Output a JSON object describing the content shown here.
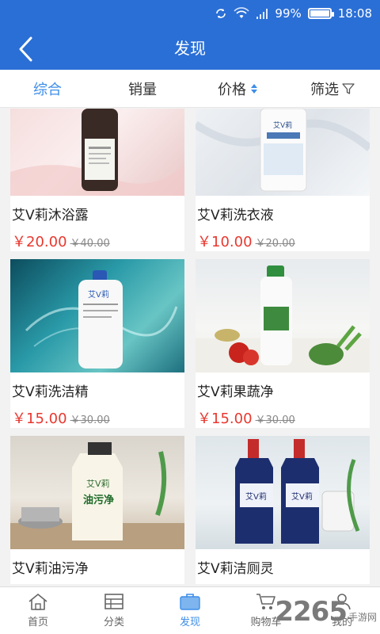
{
  "status_bar": {
    "battery": "99%",
    "time": "18:08",
    "battery_level": 0.99
  },
  "nav": {
    "title": "发现"
  },
  "tabs": [
    {
      "label": "综合"
    },
    {
      "label": "销量"
    },
    {
      "label": "价格"
    },
    {
      "label": "筛选"
    }
  ],
  "products": [
    {
      "name": "艾V莉沐浴露",
      "price": "￥20.00",
      "old_price": "￥40.00"
    },
    {
      "name": "艾V莉洗衣液",
      "price": "￥10.00",
      "old_price": "￥20.00"
    },
    {
      "name": "艾V莉洗洁精",
      "price": "￥15.00",
      "old_price": "￥30.00"
    },
    {
      "name": "艾V莉果蔬净",
      "price": "￥15.00",
      "old_price": "￥30.00"
    },
    {
      "name": "艾V莉油污净",
      "price": "",
      "old_price": ""
    },
    {
      "name": "艾V莉洁厕灵",
      "price": "",
      "old_price": ""
    }
  ],
  "product_labels": {
    "brand": "艾V莉",
    "oil_cleaner": "油污净"
  },
  "bottom_nav": [
    {
      "label": "首页"
    },
    {
      "label": "分类"
    },
    {
      "label": "发现"
    },
    {
      "label": "购物车"
    },
    {
      "label": "我的"
    }
  ],
  "watermark": {
    "number": "2265",
    "text": "手游网"
  },
  "colors": {
    "primary": "#2a6fd6",
    "accent": "#3d8ee8",
    "price": "#e8382f"
  }
}
